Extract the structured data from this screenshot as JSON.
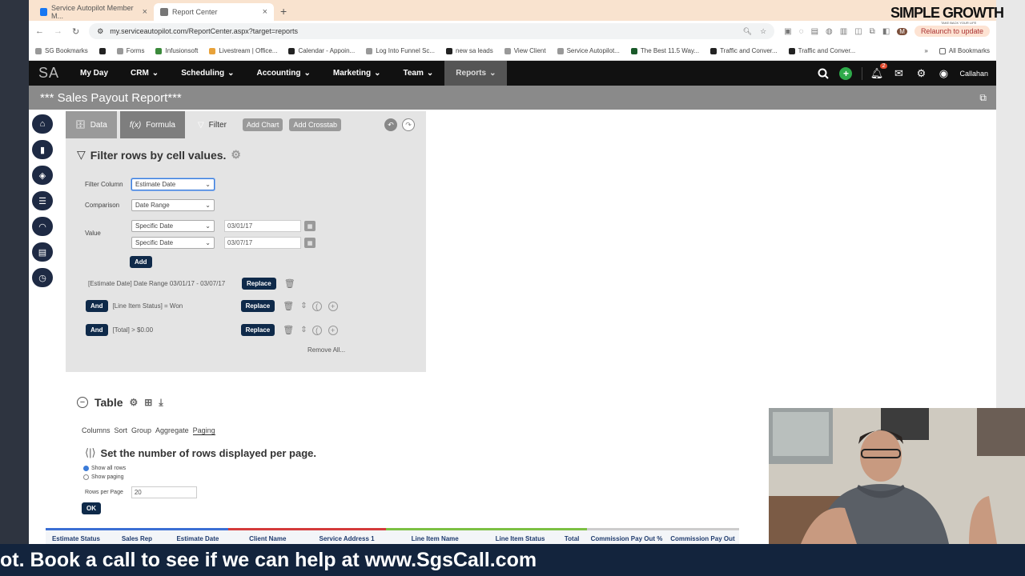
{
  "browser": {
    "tabs": [
      {
        "title": "Service Autopilot Member M...",
        "active": false
      },
      {
        "title": "Report Center",
        "active": true
      }
    ],
    "url": "my.serviceautopilot.com/ReportCenter.aspx?target=reports",
    "relaunch_label": "Relaunch to update",
    "bookmarks": [
      "SG Bookmarks",
      "Forms",
      "Infusionsoft",
      "Livestream | Office...",
      "Calendar - Appoin...",
      "Log Into Funnel Sc...",
      "new sa leads",
      "View Client",
      "Service Autopilot...",
      "The Best 11.5 Way...",
      "Traffic and Conver...",
      "Traffic and Conver..."
    ],
    "all_bookmarks": "All Bookmarks"
  },
  "app": {
    "logo": "SA",
    "nav": [
      "My Day",
      "CRM",
      "Scheduling",
      "Accounting",
      "Marketing",
      "Team",
      "Reports"
    ],
    "notification_count": "2",
    "user": "Callahan",
    "report_title": "*** Sales Payout Report***"
  },
  "toolbar": {
    "data_label": "Data",
    "formula_label": "Formula",
    "filter_label": "Filter",
    "add_chart": "Add Chart",
    "add_crosstab": "Add Crosstab"
  },
  "filter": {
    "title": "Filter rows by cell values.",
    "column_label": "Filter Column",
    "column_value": "Estimate Date",
    "comparison_label": "Comparison",
    "comparison_value": "Date Range",
    "value_label": "Value",
    "value_type_1": "Specific Date",
    "value_date_1": "03/01/17",
    "value_type_2": "Specific Date",
    "value_date_2": "03/07/17",
    "add_label": "Add",
    "criteria": [
      {
        "text": "[Estimate Date] Date Range 03/01/17 - 03/07/17",
        "connector": ""
      },
      {
        "text": "[Line Item Status] = Won",
        "connector": "And"
      },
      {
        "text": "[Total] > $0.00",
        "connector": "And"
      }
    ],
    "replace_label": "Replace",
    "remove_all": "Remove All..."
  },
  "table": {
    "title": "Table",
    "subtabs": [
      "Columns",
      "Sort",
      "Group",
      "Aggregate",
      "Paging"
    ],
    "active_subtab": "Paging",
    "paging_title": "Set the number of rows displayed per page.",
    "show_all": "Show all rows",
    "show_paging": "Show paging",
    "rows_per_page_label": "Rows per Page",
    "rows_per_page_value": "20",
    "ok_label": "OK",
    "columns": [
      {
        "name": "Estimate Status",
        "color": "#3b6fd4"
      },
      {
        "name": "Sales Rep",
        "color": "#3b6fd4"
      },
      {
        "name": "Estimate Date",
        "color": "#3b6fd4"
      },
      {
        "name": "Client Name",
        "color": "#d43b3b"
      },
      {
        "name": "Service Address 1",
        "color": "#d43b3b"
      },
      {
        "name": "Line Item Name",
        "color": "#7cc043"
      },
      {
        "name": "Line Item Status",
        "color": "#7cc043"
      },
      {
        "name": "Total",
        "color": "#7cc043"
      },
      {
        "name": "Commission Pay Out %",
        "color": "#cccccc"
      },
      {
        "name": "Commission Pay Out",
        "color": "#cccccc"
      }
    ]
  },
  "overlay": {
    "brand_line1": "SIMPLE GROWTH",
    "brand_tagline": "TAKE BACK YOUR LIFE",
    "banner_text": "ot. Book a call to see if we can help at www.SgsCall.com"
  }
}
